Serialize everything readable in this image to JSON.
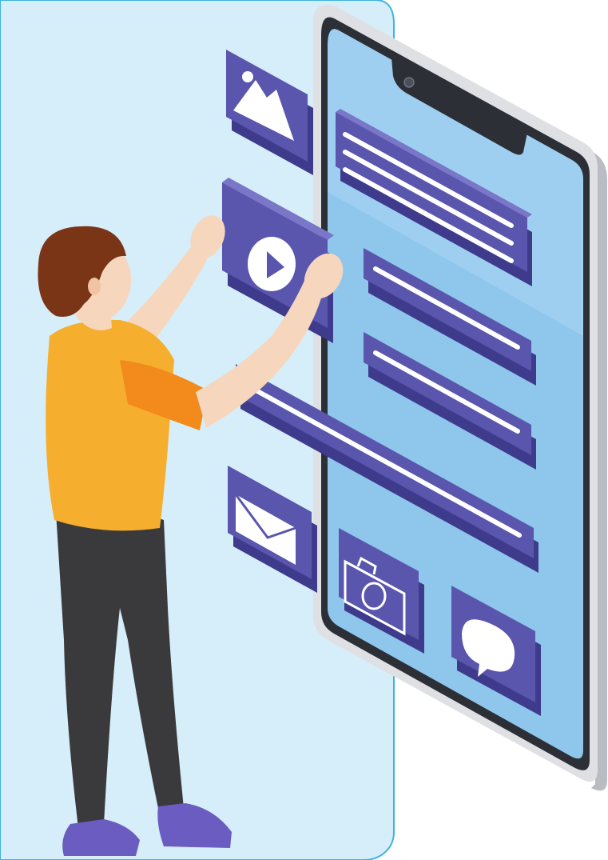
{
  "scene": {
    "description_visible_text": "",
    "colors": {
      "backdrop": "#d6edfa",
      "backdrop_edge": "#3fb2e3",
      "phone_body": "#dfe0e3",
      "phone_side": "#b9bcc2",
      "phone_bezel": "#2c2f36",
      "screen": "#8ec6ec",
      "screen_light": "#a9d6f3",
      "tile": "#5a56ad",
      "tile_dark": "#3f3b8c",
      "tile_light": "#7a76c8",
      "line": "#ffffff",
      "skin": "#f6d7bd",
      "hair": "#7a3416",
      "shirt": "#f6ae2e",
      "sleeve": "#f28a1c",
      "pants": "#3a3a3c",
      "shoes": "#6a5cc0"
    },
    "icons": [
      "image-icon",
      "play-icon",
      "mail-icon",
      "camera-icon",
      "chat-bubble-icon"
    ],
    "text_bars": 5
  }
}
